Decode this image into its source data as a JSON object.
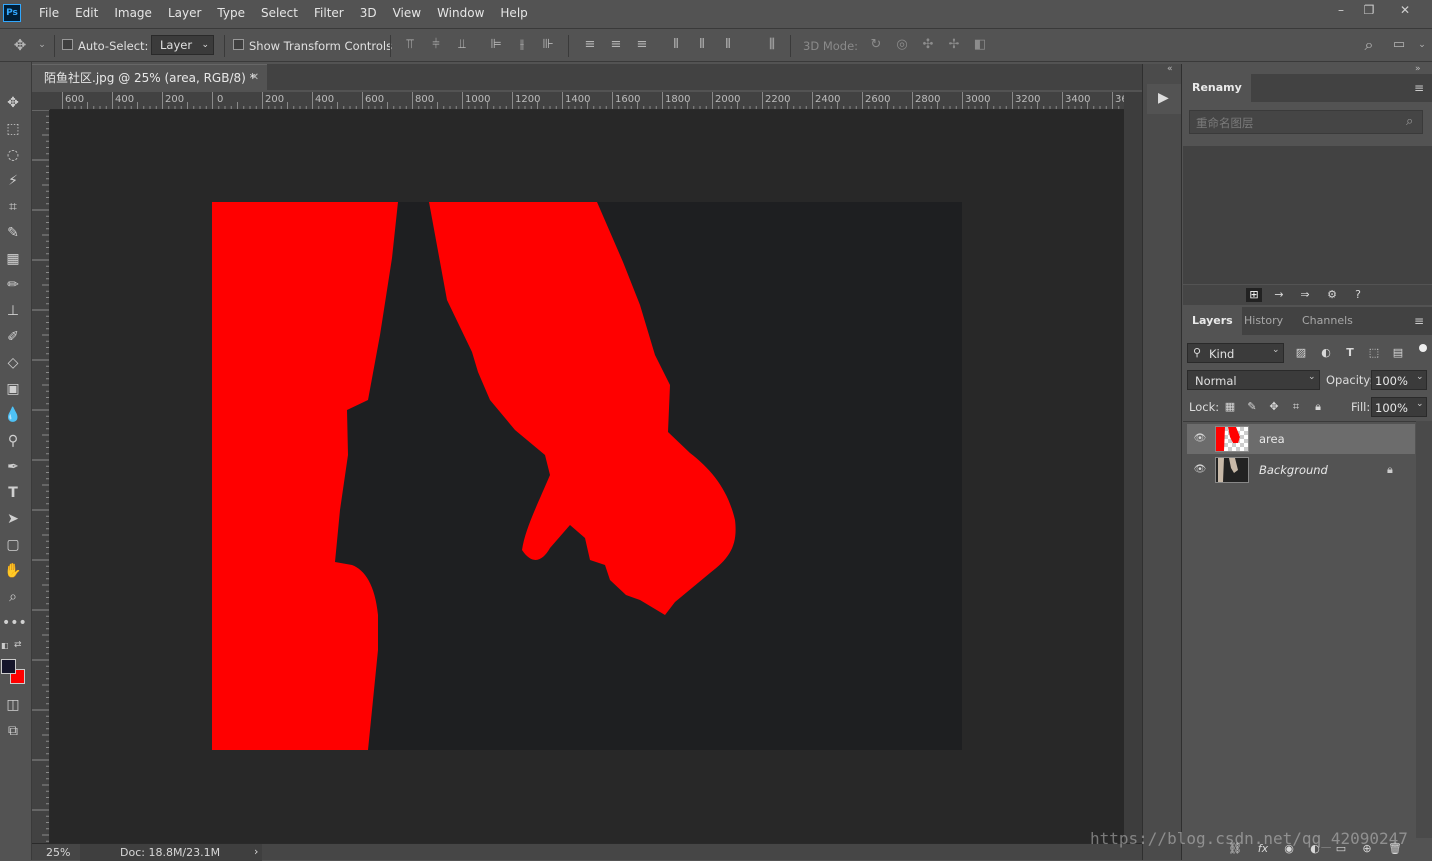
{
  "app": {
    "logo": "Ps"
  },
  "menu": [
    "File",
    "Edit",
    "Image",
    "Layer",
    "Type",
    "Select",
    "Filter",
    "3D",
    "View",
    "Window",
    "Help"
  ],
  "window_controls": {
    "minimize": "–",
    "restore": "❐",
    "close": "✕"
  },
  "options": {
    "auto_select_label": "Auto-Select:",
    "auto_select_value": "Layer",
    "show_transform_label": "Show Transform Controls",
    "mode_3d_label": "3D Mode:"
  },
  "document": {
    "tab_title": "陌鱼社区.jpg @ 25% (area, RGB/8) *",
    "zoom": "25%",
    "doc_info": "Doc: 18.8M/23.1M",
    "ruler_labels": [
      "600",
      "400",
      "200",
      "0",
      "200",
      "400",
      "600",
      "800",
      "1000",
      "1200",
      "1400",
      "1600",
      "1800",
      "2000",
      "2200",
      "2400",
      "2600",
      "2800",
      "3000",
      "3200",
      "3400",
      "36"
    ]
  },
  "colors": {
    "foreground": "#15152a",
    "background": "#ff0000",
    "mask": "#ff0000",
    "canvas_bg": "#1e1f21",
    "pasteboard": "#282828"
  },
  "renamy": {
    "title": "Renamy",
    "placeholder": "重命名图层"
  },
  "panels": {
    "tabs": [
      "Layers",
      "History",
      "Channels"
    ],
    "kind_label": "Kind",
    "blend_mode": "Normal",
    "opacity_label": "Opacity:",
    "opacity_value": "100%",
    "lock_label": "Lock:",
    "fill_label": "Fill:",
    "fill_value": "100%"
  },
  "layers": [
    {
      "name": "area",
      "selected": true
    },
    {
      "name": "Background",
      "locked": true
    }
  ],
  "watermark": "https://blog.csdn.net/qq_42090247"
}
